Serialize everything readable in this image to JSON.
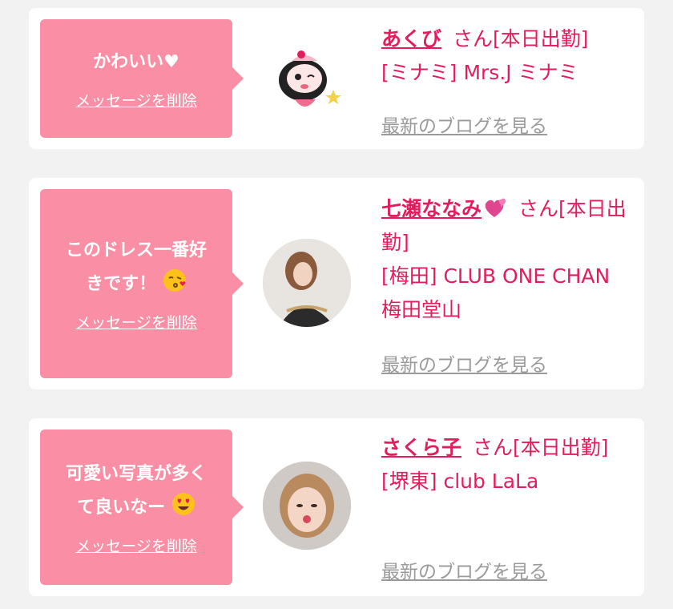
{
  "colors": {
    "accent": "#e31d5c",
    "bubble": "#f98ea4",
    "link_gray": "#9a9a9a",
    "background": "#f2f2f2"
  },
  "cards": [
    {
      "message": "かわいい♥",
      "delete_label": "メッセージを削除",
      "name": "あくび",
      "status": "さん[本日出勤]",
      "shop": "[ミナミ] Mrs.J ミナミ",
      "blog_link": "最新のブログを見る",
      "avatar": "cartoon-character-icon"
    },
    {
      "message_line1": "このドレス一番好",
      "message_line2": "きです！",
      "message_emoji": "kissing-face-icon",
      "delete_label": "メッセージを削除",
      "name": "七瀬ななみ",
      "name_emoji": "two-hearts-icon",
      "status": "さん[本日出勤]",
      "shop": "[梅田] CLUB ONE CHAN 梅田堂山",
      "blog_link": "最新のブログを見る",
      "avatar": "profile-photo"
    },
    {
      "message_line1": "可愛い写真が多く",
      "message_line2": "て良いなー",
      "message_emoji": "heart-eyes-face-icon",
      "delete_label": "メッセージを削除",
      "name": "さくら子",
      "status": "さん[本日出勤]",
      "shop": "[堺東] club LaLa",
      "blog_link": "最新のブログを見る",
      "avatar": "profile-photo"
    }
  ]
}
